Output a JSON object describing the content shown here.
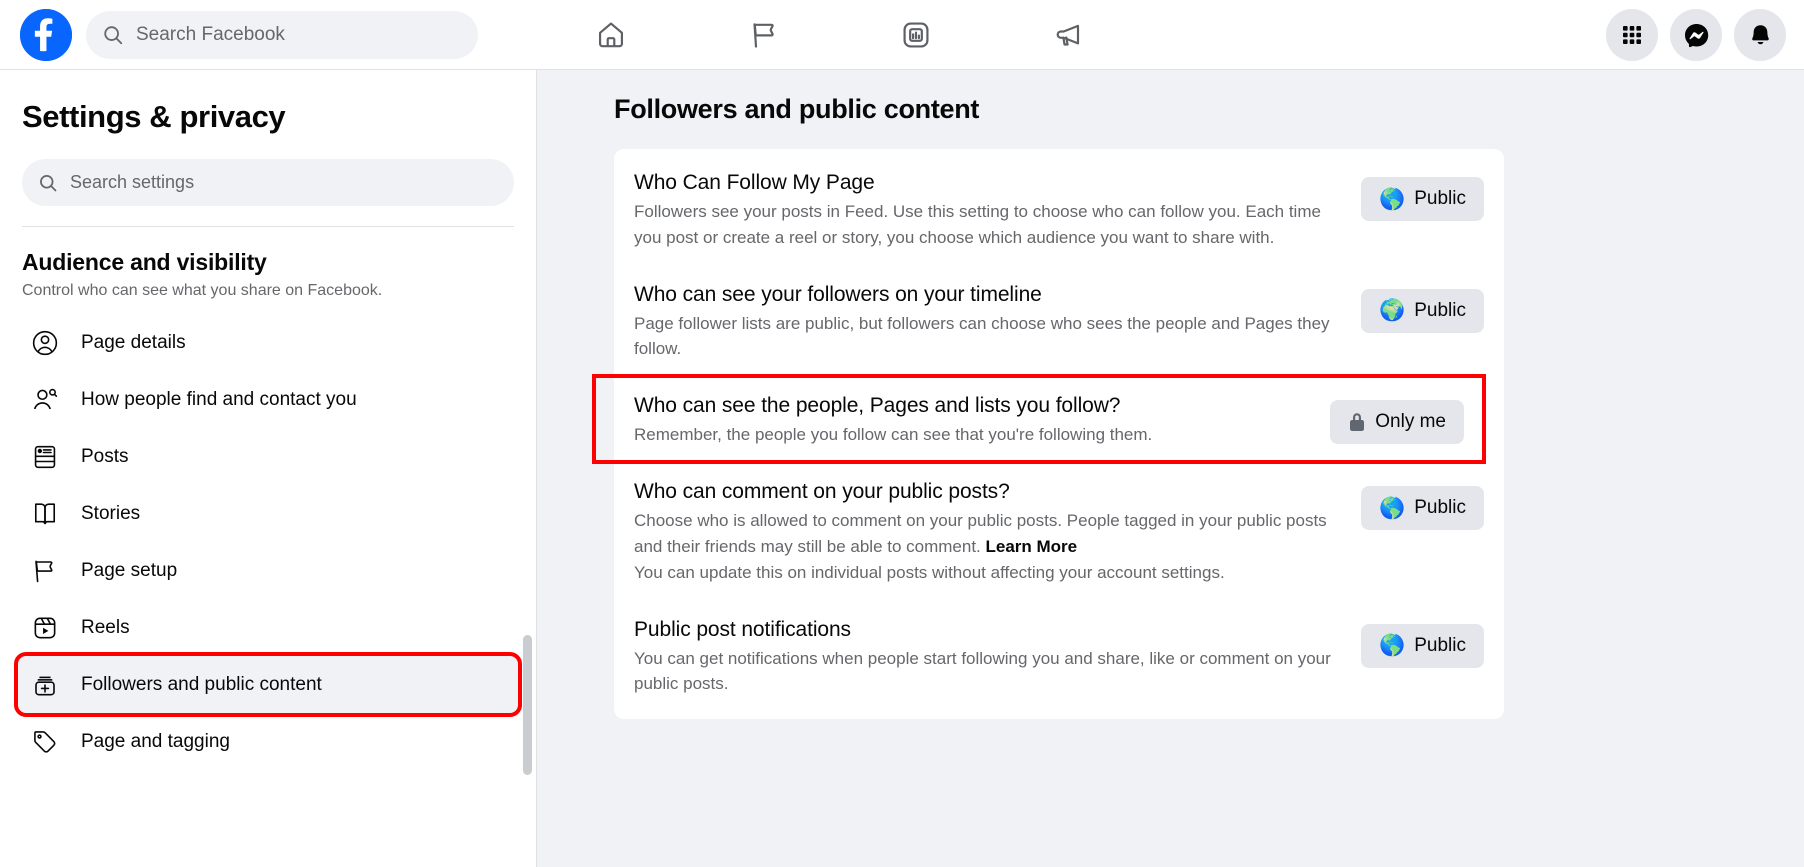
{
  "topbar": {
    "logo_name": "facebook-logo",
    "search_placeholder": "Search Facebook",
    "search_value": "",
    "nav": [
      {
        "name": "home-icon",
        "label": "Home"
      },
      {
        "name": "flag-icon",
        "label": "Page"
      },
      {
        "name": "bar-chart-icon",
        "label": "Insights"
      },
      {
        "name": "megaphone-icon",
        "label": "Ads"
      }
    ],
    "right": [
      {
        "name": "grid-menu-icon",
        "label": "Menu"
      },
      {
        "name": "messenger-icon",
        "label": "Messenger"
      },
      {
        "name": "bell-icon",
        "label": "Notifications"
      }
    ]
  },
  "sidebar": {
    "title": "Settings & privacy",
    "search_placeholder": "Search settings",
    "search_value": "",
    "section_title": "Audience and visibility",
    "section_subtitle": "Control who can see what you share on Facebook.",
    "items": [
      {
        "label": "Page details",
        "icon": "person-circle-icon"
      },
      {
        "label": "How people find and contact you",
        "icon": "person-search-icon"
      },
      {
        "label": "Posts",
        "icon": "posts-card-icon"
      },
      {
        "label": "Stories",
        "icon": "book-icon"
      },
      {
        "label": "Page setup",
        "icon": "flag-outline-icon"
      },
      {
        "label": "Reels",
        "icon": "reels-icon"
      },
      {
        "label": "Followers and public content",
        "icon": "followers-plus-icon"
      },
      {
        "label": "Page and tagging",
        "icon": "tag-icon"
      }
    ],
    "active_index": 6,
    "highlight_index": 6,
    "highlight_color": "#ff0000"
  },
  "main": {
    "title": "Followers and public content",
    "settings": [
      {
        "heading": "Who Can Follow My Page",
        "description": "Followers see your posts in Feed. Use this setting to choose who can follow you. Each time you post or create a reel or story, you choose which audience you want to share with.",
        "value": "Public",
        "value_icon": "globe-icon",
        "highlighted": false
      },
      {
        "heading": "Who can see your followers on your timeline",
        "description": "Page follower lists are public, but followers can choose who sees the people and Pages they follow.",
        "value": "Public",
        "value_icon": "globe-icon",
        "highlighted": false
      },
      {
        "heading": "Who can see the people, Pages and lists you follow?",
        "description": "Remember, the people you follow can see that you're following them.",
        "value": "Only me",
        "value_icon": "lock-icon",
        "highlighted": true
      },
      {
        "heading": "Who can comment on your public posts?",
        "description": "Choose who is allowed to comment on your public posts. People tagged in your public posts and their friends may still be able to comment. ",
        "description_link": "Learn More",
        "description_extra": "You can update this on individual posts without affecting your account settings.",
        "value": "Public",
        "value_icon": "globe-icon",
        "highlighted": false
      },
      {
        "heading": "Public post notifications",
        "description": "You can get notifications when people start following you and share, like or comment on your public posts.",
        "value": "Public",
        "value_icon": "globe-icon",
        "highlighted": false
      }
    ]
  },
  "colors": {
    "brand_blue": "#0866ff",
    "highlight_red": "#ff0000",
    "page_bg": "#f0f2f5",
    "card_bg": "#ffffff",
    "text_primary": "#080809",
    "text_secondary": "#65676b"
  }
}
